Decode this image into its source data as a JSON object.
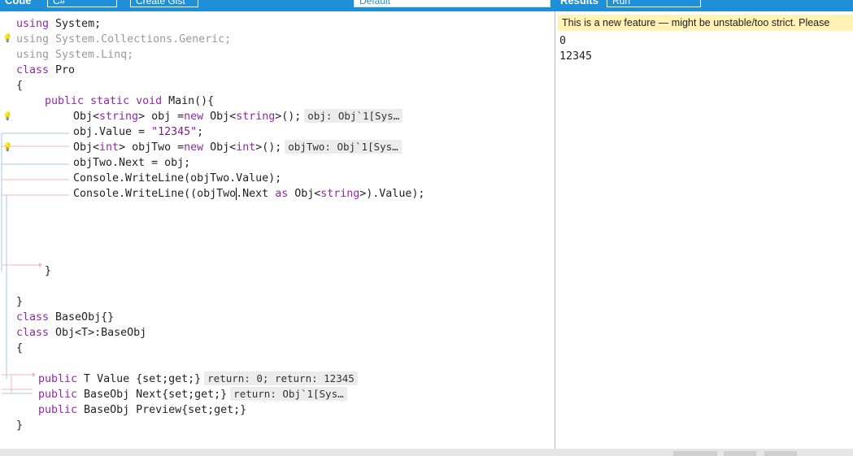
{
  "toolbar": {
    "code_label": "Code",
    "language_value": "C#",
    "create_gist_label": "Create Gist",
    "theme_value": "Default",
    "results_label": "Results",
    "run_label": "Run"
  },
  "code": {
    "line1_kw": "using",
    "line1_rest": " System;",
    "line2": "using System.Collections.Generic;",
    "line3": "using System.Linq;",
    "line4_kw": "class",
    "line4_rest": " Pro",
    "line5": "{",
    "line6_kw": "public static void",
    "line6_rest": " Main(){",
    "line7_a": "Obj<",
    "line7_type": "string",
    "line7_b": "> obj =",
    "line7_new": "new",
    "line7_c": " Obj<",
    "line7_type2": "string",
    "line7_d": ">();",
    "line7_hint": "obj: Obj`1[Sys…",
    "line8_a": "obj.Value = ",
    "line8_str": "\"12345\"",
    "line8_b": ";",
    "line9_a": "Obj<",
    "line9_type": "int",
    "line9_b": "> objTwo =",
    "line9_new": "new",
    "line9_c": " Obj<",
    "line9_type2": "int",
    "line9_d": ">();",
    "line9_hint": "objTwo: Obj`1[Sys…",
    "line10": "objTwo.Next = obj;",
    "line11": "Console.WriteLine(objTwo.Value);",
    "line12_a": "Console.WriteLine((objTwo",
    "line12_b": ".Next ",
    "line12_as": "as",
    "line12_c": " Obj<",
    "line12_type": "string",
    "line12_d": ">).Value);",
    "line13": "}",
    "line14": "}",
    "line15_kw": "class",
    "line15_rest": " BaseObj{}",
    "line16_kw": "class",
    "line16_rest": " Obj<T>:BaseObj",
    "line17": "{",
    "line18_kw": "public",
    "line18_rest": " T Value {set;get;}",
    "line18_hint": "return: 0; return: 12345",
    "line19_kw": "public",
    "line19_rest": " BaseObj Next{set;get;}",
    "line19_hint": "return: Obj`1[Sys…",
    "line20_kw": "public",
    "line20_rest": " BaseObj Preview{set;get;}",
    "line21": "}"
  },
  "results": {
    "warning": "This is a new feature — might be unstable/too strict. Please ",
    "output": [
      "0",
      "12345"
    ]
  },
  "colors": {
    "toolbar": "#1f8fd8",
    "keyword": "#8e2aa6",
    "warning_bg": "#fff3b5"
  }
}
